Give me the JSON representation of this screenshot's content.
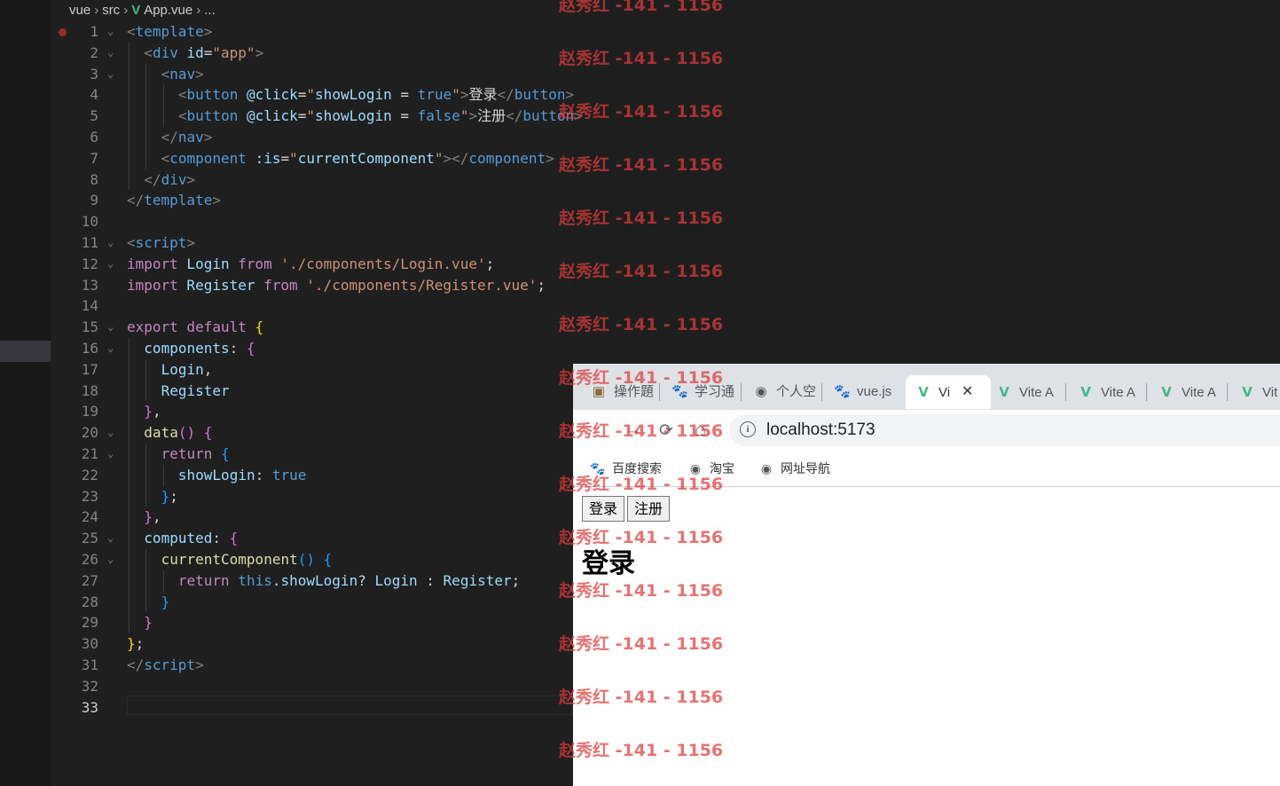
{
  "breadcrumb": {
    "items": [
      "vue",
      "src",
      "App.vue",
      "..."
    ]
  },
  "editor": {
    "current_line": 33,
    "lines": [
      {
        "n": 1,
        "fold": true,
        "code": [
          [
            "<",
            "p"
          ],
          [
            "template",
            "t"
          ],
          [
            ">",
            "p"
          ]
        ]
      },
      {
        "n": 2,
        "fold": true,
        "indent": 1,
        "code": [
          [
            "<",
            "p"
          ],
          [
            "div",
            "t"
          ],
          [
            " id",
            "a"
          ],
          [
            "=",
            "w"
          ],
          [
            "\"app\"",
            "s"
          ],
          [
            ">",
            "p"
          ]
        ]
      },
      {
        "n": 3,
        "fold": true,
        "indent": 2,
        "code": [
          [
            "<",
            "p"
          ],
          [
            "nav",
            "t"
          ],
          [
            ">",
            "p"
          ]
        ]
      },
      {
        "n": 4,
        "indent": 3,
        "code": [
          [
            "<",
            "p"
          ],
          [
            "button",
            "t"
          ],
          [
            " @click",
            "a"
          ],
          [
            "=",
            "w"
          ],
          [
            "\"",
            "s"
          ],
          [
            "showLogin",
            "v"
          ],
          [
            " = ",
            "w"
          ],
          [
            "true",
            "t"
          ],
          [
            "\"",
            "s"
          ],
          [
            ">",
            "p"
          ],
          [
            "登录",
            "w"
          ],
          [
            "</",
            "p"
          ],
          [
            "button",
            "t"
          ],
          [
            ">",
            "p"
          ]
        ]
      },
      {
        "n": 5,
        "indent": 3,
        "code": [
          [
            "<",
            "p"
          ],
          [
            "button",
            "t"
          ],
          [
            " @click",
            "a"
          ],
          [
            "=",
            "w"
          ],
          [
            "\"",
            "s"
          ],
          [
            "showLogin",
            "v"
          ],
          [
            " = ",
            "w"
          ],
          [
            "false",
            "t"
          ],
          [
            "\"",
            "s"
          ],
          [
            ">",
            "p"
          ],
          [
            "注册",
            "w"
          ],
          [
            "</",
            "p"
          ],
          [
            "button",
            "t"
          ],
          [
            ">",
            "p"
          ]
        ]
      },
      {
        "n": 6,
        "indent": 2,
        "code": [
          [
            "</",
            "p"
          ],
          [
            "nav",
            "t"
          ],
          [
            ">",
            "p"
          ]
        ]
      },
      {
        "n": 7,
        "indent": 2,
        "code": [
          [
            "<",
            "p"
          ],
          [
            "component",
            "t"
          ],
          [
            " :is",
            "a"
          ],
          [
            "=",
            "w"
          ],
          [
            "\"",
            "s"
          ],
          [
            "currentComponent",
            "v"
          ],
          [
            "\"",
            "s"
          ],
          [
            "></",
            "p"
          ],
          [
            "component",
            "t"
          ],
          [
            ">",
            "p"
          ]
        ]
      },
      {
        "n": 8,
        "indent": 1,
        "code": [
          [
            "</",
            "p"
          ],
          [
            "div",
            "t"
          ],
          [
            ">",
            "p"
          ]
        ]
      },
      {
        "n": 9,
        "code": [
          [
            "</",
            "p"
          ],
          [
            "template",
            "t"
          ],
          [
            ">",
            "p"
          ]
        ]
      },
      {
        "n": 10,
        "code": []
      },
      {
        "n": 11,
        "fold": true,
        "code": [
          [
            "<",
            "p"
          ],
          [
            "script",
            "t"
          ],
          [
            ">",
            "p"
          ]
        ]
      },
      {
        "n": 12,
        "fold": true,
        "code": [
          [
            "import",
            "k"
          ],
          [
            " Login ",
            "v"
          ],
          [
            "from",
            "k"
          ],
          [
            " './components/Login.vue'",
            "s"
          ],
          [
            ";",
            "w"
          ]
        ]
      },
      {
        "n": 13,
        "code": [
          [
            "import",
            "k"
          ],
          [
            " Register ",
            "v"
          ],
          [
            "from",
            "k"
          ],
          [
            " './components/Register.vue'",
            "s"
          ],
          [
            ";",
            "w"
          ]
        ]
      },
      {
        "n": 14,
        "code": []
      },
      {
        "n": 15,
        "fold": true,
        "code": [
          [
            "export",
            "k"
          ],
          [
            " default ",
            "k"
          ],
          [
            "{",
            "y"
          ]
        ]
      },
      {
        "n": 16,
        "fold": true,
        "indent": 1,
        "code": [
          [
            "components",
            "v"
          ],
          [
            ": ",
            "w"
          ],
          [
            "{",
            "m"
          ]
        ]
      },
      {
        "n": 17,
        "indent": 2,
        "code": [
          [
            "Login",
            "v"
          ],
          [
            ",",
            "w"
          ]
        ]
      },
      {
        "n": 18,
        "indent": 2,
        "code": [
          [
            "Register",
            "v"
          ]
        ]
      },
      {
        "n": 19,
        "indent": 1,
        "code": [
          [
            "}",
            "m"
          ],
          [
            ",",
            "w"
          ]
        ]
      },
      {
        "n": 20,
        "fold": true,
        "indent": 1,
        "code": [
          [
            "data",
            "f"
          ],
          [
            "()",
            "m"
          ],
          [
            " ",
            "w"
          ],
          [
            "{",
            "m"
          ]
        ]
      },
      {
        "n": 21,
        "fold": true,
        "indent": 2,
        "code": [
          [
            "return",
            "k"
          ],
          [
            " ",
            "w"
          ],
          [
            "{",
            "b"
          ]
        ]
      },
      {
        "n": 22,
        "indent": 3,
        "code": [
          [
            "showLogin",
            "v"
          ],
          [
            ": ",
            "w"
          ],
          [
            "true",
            "t"
          ]
        ]
      },
      {
        "n": 23,
        "indent": 2,
        "code": [
          [
            "}",
            "b"
          ],
          [
            ";",
            "w"
          ]
        ]
      },
      {
        "n": 24,
        "indent": 1,
        "code": [
          [
            "}",
            "m"
          ],
          [
            ",",
            "w"
          ]
        ]
      },
      {
        "n": 25,
        "fold": true,
        "indent": 1,
        "code": [
          [
            "computed",
            "v"
          ],
          [
            ": ",
            "w"
          ],
          [
            "{",
            "m"
          ]
        ]
      },
      {
        "n": 26,
        "fold": true,
        "indent": 2,
        "code": [
          [
            "currentComponent",
            "f"
          ],
          [
            "()",
            "b"
          ],
          [
            " ",
            "w"
          ],
          [
            "{",
            "b"
          ]
        ]
      },
      {
        "n": 27,
        "indent": 3,
        "code": [
          [
            "return",
            "k"
          ],
          [
            " this",
            "t"
          ],
          [
            ".",
            "w"
          ],
          [
            "showLogin",
            "v"
          ],
          [
            "? ",
            "w"
          ],
          [
            "Login",
            "v"
          ],
          [
            " : ",
            "w"
          ],
          [
            "Register",
            "v"
          ],
          [
            ";",
            "w"
          ]
        ]
      },
      {
        "n": 28,
        "indent": 2,
        "code": [
          [
            "}",
            "b"
          ]
        ]
      },
      {
        "n": 29,
        "indent": 1,
        "code": [
          [
            "}",
            "m"
          ]
        ]
      },
      {
        "n": 30,
        "code": [
          [
            "}",
            "y"
          ],
          [
            ";",
            "w"
          ]
        ]
      },
      {
        "n": 31,
        "code": [
          [
            "</",
            "p"
          ],
          [
            "script",
            "t"
          ],
          [
            ">",
            "p"
          ]
        ]
      },
      {
        "n": 32,
        "code": []
      },
      {
        "n": 33,
        "code": []
      }
    ]
  },
  "browser": {
    "tabs": [
      {
        "icon": "task-icon",
        "label": "操作題"
      },
      {
        "icon": "baidu-paw-icon",
        "label": "学习通"
      },
      {
        "icon": "globe-icon",
        "label": "个人空"
      },
      {
        "icon": "baidu-paw-icon",
        "label": "vue.js"
      },
      {
        "icon": "vue-logo-icon",
        "label": "Vi",
        "active": true
      },
      {
        "icon": "vue-logo-icon",
        "label": "Vite A"
      },
      {
        "icon": "vue-logo-icon",
        "label": "Vite A"
      },
      {
        "icon": "vue-logo-icon",
        "label": "Vite A"
      },
      {
        "icon": "vue-logo-icon",
        "label": "Vit"
      }
    ],
    "tab_close": "✕",
    "nav": {
      "back": "←",
      "forward": "→",
      "reload": "⟳",
      "home": "⌂"
    },
    "url": "localhost:5173",
    "bookmarks": [
      {
        "icon": "baidu-paw-icon",
        "label": "百度搜索"
      },
      {
        "icon": "globe-icon",
        "label": "淘宝"
      },
      {
        "icon": "globe-icon",
        "label": "网址导航"
      }
    ],
    "page": {
      "buttons": [
        "登录",
        "注册"
      ],
      "heading": "登录"
    }
  },
  "watermark": "赵秀红 -141 - 1156",
  "colors": {
    "editor_bg": "#1f1f1f",
    "tag": "#569cd6",
    "string": "#ce9178",
    "keyword": "#c586c0",
    "variable": "#9cdcfe",
    "function": "#dcdcaa",
    "vue_green": "#41b883",
    "watermark": "#dc3c3c"
  }
}
